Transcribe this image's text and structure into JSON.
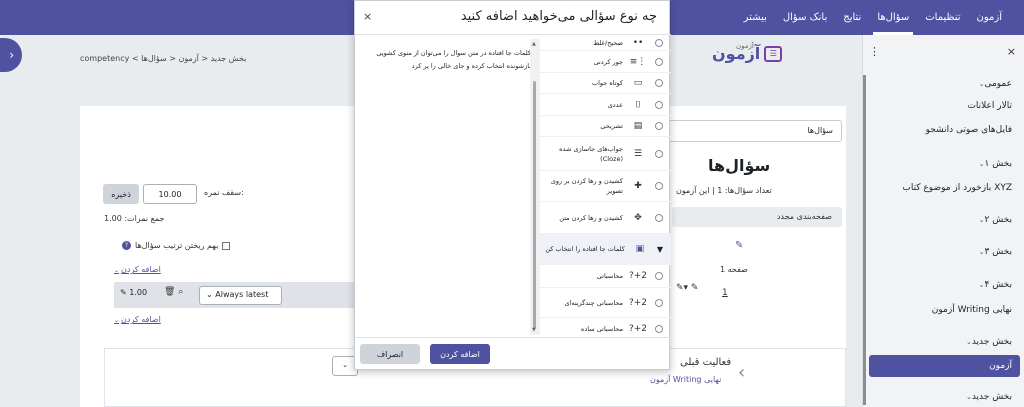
{
  "navbar": {
    "items": [
      {
        "label": "آزمون",
        "active": false
      },
      {
        "label": "تنظیمات",
        "active": false
      },
      {
        "label": "سؤال‌ها",
        "active": true
      },
      {
        "label": "نتایج",
        "active": false
      },
      {
        "label": "بانک سؤال",
        "active": false
      },
      {
        "label": "بیشتر",
        "active": false
      }
    ]
  },
  "drawer": {
    "close_icon": "×",
    "dots_icon": "⋮",
    "items": [
      {
        "label": "عمومی",
        "type": "section"
      },
      {
        "label": "تالار اعلانات",
        "type": "item"
      },
      {
        "label": "فایل‌های صوتی دانشجو",
        "type": "item"
      },
      {
        "label": "بخش ۱",
        "type": "section"
      },
      {
        "label": "بازخورد از موضوع کتاب XYZ",
        "type": "item"
      },
      {
        "label": "بخش ۲",
        "type": "section"
      },
      {
        "label": "بخش ۳",
        "type": "section"
      },
      {
        "label": "بخش ۴",
        "type": "section"
      },
      {
        "label": "آزمون Writing نهایی",
        "type": "item"
      },
      {
        "label": "بخش جدید",
        "type": "section"
      },
      {
        "label": "آزمون",
        "type": "current"
      },
      {
        "label": "بخش جدید",
        "type": "section"
      }
    ]
  },
  "logo": {
    "text": "آزمون",
    "sub": "آزمون"
  },
  "breadcrumb": {
    "items": [
      "competency",
      "بخش جدید",
      "آزمون",
      "سؤال‌ها"
    ],
    "separator": "<"
  },
  "page": {
    "select_value": "سؤال‌ها",
    "title": "سؤال‌ها",
    "count_text": "تعداد سؤال‌ها: 1 | این آزمون",
    "tab_label": "صفحه‌بندی مجدد",
    "page_label": "صفحه 1",
    "slot_number": "1",
    "save_label": "ذخیره",
    "max_grade_value": "10.00",
    "max_grade_label": "سقف نمره:",
    "total_grade": "جمع نمرات: 1.00",
    "shuffle_label": "بهم ریختن ترتیب سؤال‌ها",
    "add_link_1": "اضافه کردن",
    "add_link_2": "اضافه کردن",
    "slot_grade": "1.00",
    "version_select": "Always latest",
    "activity_title": "فعالیت قبلی",
    "activity_sub": "آزمون Writing نهایی"
  },
  "modal": {
    "title": "چه نوع سؤالی می‌خواهید اضافه کنید",
    "close_icon": "×",
    "description": "کلمات جا افتاده در متن سوال را می‌توان از منوی کشویی بازشونده انتخاب کرده و جای خالی را پر کرد",
    "question_types": [
      {
        "label": "صحیح/غلط",
        "icon": "••",
        "selected": false
      },
      {
        "label": "جور کردنی",
        "icon": "⋮≡",
        "selected": false
      },
      {
        "label": "کوتاه جواب",
        "icon": "▭",
        "selected": false
      },
      {
        "label": "عددی",
        "icon": "⌷",
        "selected": false
      },
      {
        "label": "تشریحی",
        "icon": "▤",
        "selected": false
      },
      {
        "label": "جواب‌های جاسازی شده (Cloze)",
        "icon": "☰",
        "selected": false
      },
      {
        "label": "کشیدن و رها کردن بر روی تصویر",
        "icon": "✚",
        "selected": false
      },
      {
        "label": "کشیدن و رها کردن متن",
        "icon": "✥",
        "selected": false
      },
      {
        "label": "کلمات جا افتاده را انتخاب کن",
        "icon": "▣",
        "selected": true
      },
      {
        "label": "محاسباتی",
        "icon": "2+?",
        "selected": false
      },
      {
        "label": "محاسباتی چندگزینه‌ای",
        "icon": "2+?",
        "selected": false
      },
      {
        "label": "محاسباتی ساده",
        "icon": "2+?",
        "selected": false
      }
    ],
    "add_button": "اضافه کردن",
    "cancel_button": "انصراف"
  }
}
